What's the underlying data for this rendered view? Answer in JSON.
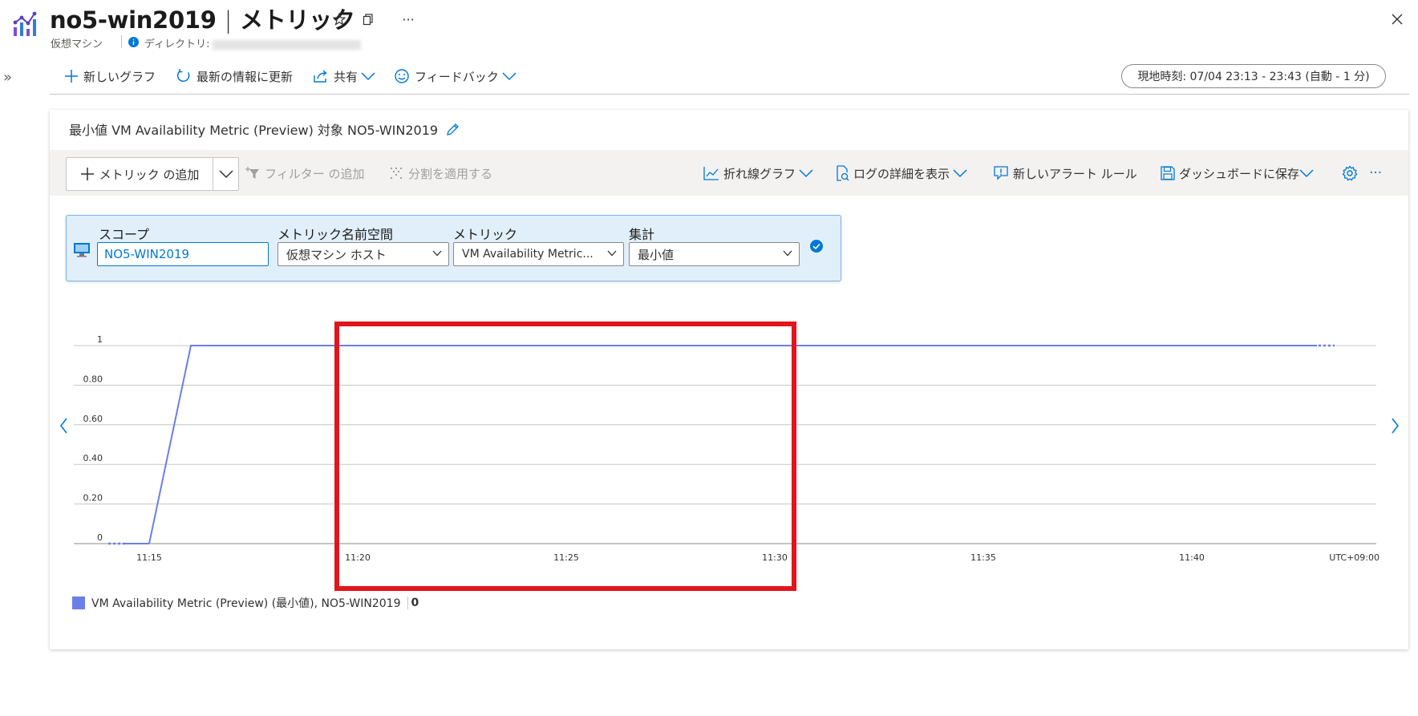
{
  "header": {
    "resource_name": "no5-win2019",
    "separator": "|",
    "blade_title": "メトリック",
    "resource_type": "仮想マシン",
    "directory_label": "ディレクトリ:",
    "star_icon": "star-icon",
    "copy_icon": "copy-icon",
    "more_icon": "ellipsis-icon",
    "close_icon": "close-icon"
  },
  "commandbar": {
    "new_chart": "新しいグラフ",
    "refresh": "最新の情報に更新",
    "share": "共有",
    "feedback": "フィードバック",
    "time_range": "現地時刻: 07/04 23:13 - 23:43 (自動 - 1 分)"
  },
  "chart_card": {
    "title": "最小値 VM Availability Metric (Preview) 対象 NO5-WIN2019",
    "toolbar": {
      "add_metric": "メトリック の追加",
      "add_filter": "フィルター の追加",
      "apply_split": "分割を適用する",
      "line_chart": "折れ線グラフ",
      "show_logs": "ログの詳細を表示",
      "new_alert": "新しいアラート ルール",
      "save_dashboard": "ダッシュボードに保存"
    },
    "selector": {
      "scope_label": "スコープ",
      "scope_value": "NO5-WIN2019",
      "namespace_label": "メトリック名前空間",
      "namespace_value": "仮想マシン ホスト",
      "metric_label": "メトリック",
      "metric_value": "VM Availability Metric...",
      "aggregation_label": "集計",
      "aggregation_value": "最小値"
    },
    "legend": {
      "series_label": "VM Availability Metric (Preview) (最小値), NO5-WIN2019",
      "series_value": "0"
    },
    "timezone": "UTC+09:00"
  },
  "colors": {
    "accent": "#0078d4",
    "series": "#6b7ee9",
    "highlight_box": "#e3141b"
  },
  "chart_data": {
    "type": "line",
    "title": "",
    "xlabel": "",
    "ylabel": "",
    "x_ticks": [
      "11:15",
      "11:20",
      "11:25",
      "11:30",
      "11:35",
      "11:40"
    ],
    "y_ticks": [
      "0",
      "0.20",
      "0.40",
      "0.60",
      "0.80",
      "1"
    ],
    "ylim": [
      0,
      1
    ],
    "xlim": [
      "11:14",
      "11:45"
    ],
    "grid": true,
    "series": [
      {
        "name": "VM Availability Metric (Preview) (最小値), NO5-WIN2019",
        "x": [
          "11:15",
          "11:16",
          "11:17",
          "11:18",
          "11:19",
          "11:20",
          "11:21",
          "11:22",
          "11:23",
          "11:24",
          "11:25",
          "11:26",
          "11:27",
          "11:28",
          "11:29",
          "11:30",
          "11:31",
          "11:32",
          "11:33",
          "11:34",
          "11:35",
          "11:36",
          "11:37",
          "11:38",
          "11:39",
          "11:40",
          "11:41",
          "11:42",
          "11:43"
        ],
        "values": [
          0,
          1,
          1,
          1,
          1,
          1,
          1,
          1,
          1,
          1,
          1,
          1,
          1,
          1,
          1,
          1,
          1,
          1,
          1,
          1,
          1,
          1,
          1,
          1,
          1,
          1,
          1,
          1,
          1
        ]
      }
    ]
  }
}
